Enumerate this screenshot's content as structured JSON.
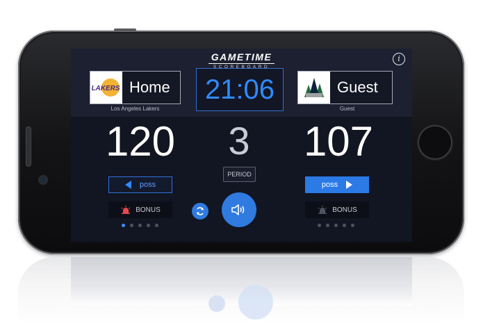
{
  "app": {
    "title": "GAMETIME",
    "subtitle": "SCOREBOARD"
  },
  "clock": "21:06",
  "home": {
    "label": "Home",
    "team": "Los Angeles Lakers",
    "logo_text": "LAKERS",
    "score": "120",
    "poss_label": "poss",
    "bonus_label": "BONUS",
    "has_possession": false
  },
  "guest": {
    "label": "Guest",
    "team": "Guest",
    "score": "107",
    "poss_label": "poss",
    "bonus_label": "BONUS",
    "has_possession": true
  },
  "period": {
    "value": "3",
    "label": "PERIOD"
  },
  "pager": {
    "left_active": 0,
    "right_active": -1,
    "count": 5
  },
  "colors": {
    "accent": "#2f7be0",
    "clock": "#2f8bff",
    "screen_bg": "#1d2030",
    "bonus_alarm_home": "#e5484d",
    "bonus_alarm_guest": "#4e5361"
  }
}
